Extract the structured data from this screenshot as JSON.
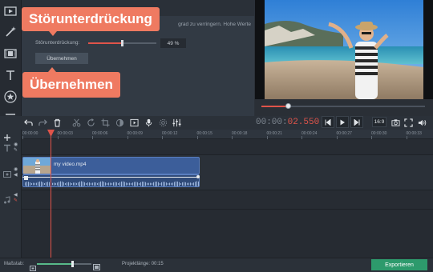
{
  "tools": [
    {
      "name": "video-icon"
    },
    {
      "name": "magic-wand-icon"
    },
    {
      "name": "filmstrip-icon"
    },
    {
      "name": "text-icon"
    },
    {
      "name": "star-icon"
    },
    {
      "name": "list-icon"
    }
  ],
  "noise_panel": {
    "description": "grad zu verringern. Hohe Werte",
    "label": "Störunterdrückung:",
    "value_text": "49 %",
    "value": 0.49,
    "apply_label": "Übernehmen"
  },
  "callouts": {
    "noise": "Störunterdrückung",
    "apply": "Übernehmen"
  },
  "preview": {
    "progress": 0.16
  },
  "timecode": {
    "dim": "00:00:",
    "active": "02.550"
  },
  "aspect_ratio": "16:9",
  "ruler_ticks": [
    "00:00:00",
    "00:00:03",
    "00:00:06",
    "00:00:09",
    "00:00:12",
    "00:00:15",
    "00:00:18",
    "00:00:21",
    "00:00:24",
    "00:00:27",
    "00:00:30",
    "00:00:33"
  ],
  "clip": {
    "name": "my video.mp4"
  },
  "footer": {
    "scale_label": "Maßstab:",
    "zoom": 0.65,
    "project_length": "Projektlänge: 00:15",
    "export_label": "Exportieren"
  },
  "colors": {
    "accent": "#e0544a",
    "callout": "#ef7a61",
    "export": "#2d9a6c",
    "clip": "#3c5e9a"
  }
}
